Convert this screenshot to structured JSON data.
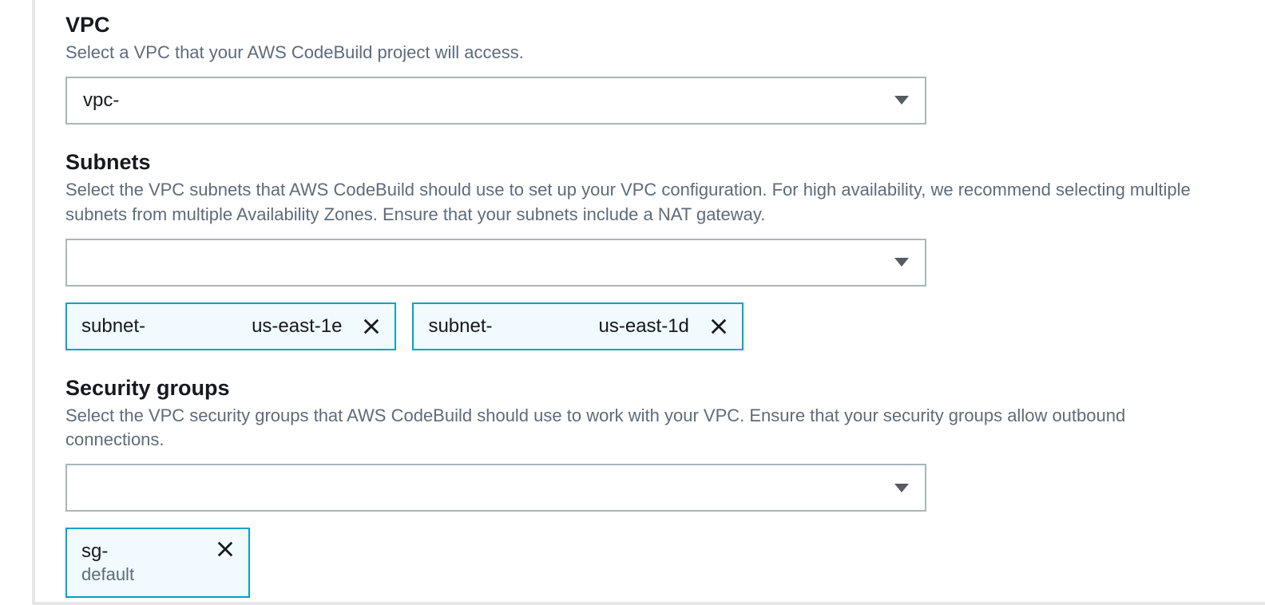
{
  "vpc": {
    "label": "VPC",
    "description": "Select a VPC that your AWS CodeBuild project will access.",
    "selected": "vpc-"
  },
  "subnets": {
    "label": "Subnets",
    "description": "Select the VPC subnets that AWS CodeBuild should use to set up your VPC configuration. For high availability, we recommend selecting multiple subnets from multiple Availability Zones. Ensure that your subnets include a NAT gateway.",
    "selected": "",
    "chips": [
      {
        "id": "subnet-",
        "az": "us-east-1e"
      },
      {
        "id": "subnet-",
        "az": "us-east-1d"
      }
    ]
  },
  "securityGroups": {
    "label": "Security groups",
    "description": "Select the VPC security groups that AWS CodeBuild should use to work with your VPC. Ensure that your security groups allow outbound connections.",
    "selected": "",
    "chips": [
      {
        "id": "sg-",
        "name": "default"
      }
    ]
  }
}
